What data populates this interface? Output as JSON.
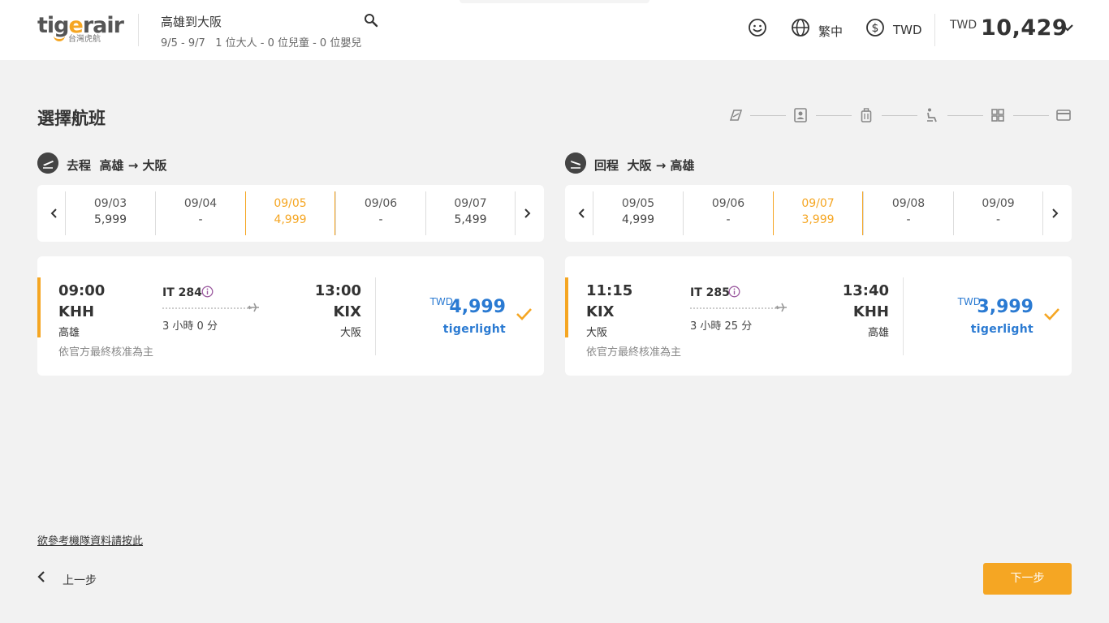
{
  "header": {
    "logo_text": "tigerair",
    "logo_sub": "台灣虎航",
    "route_title": "高雄到大阪",
    "route_dates": "9/5 - 9/7",
    "passengers": "1 位大人 - 0 位兒童 - 0 位嬰兒",
    "language": "繁中",
    "currency": "TWD",
    "total_currency": "TWD",
    "total_amount": "10,429"
  },
  "page": {
    "title": "選擇航班",
    "steps": [
      "flight-icon",
      "passenger-icon",
      "baggage-icon",
      "seat-icon",
      "extras-icon",
      "payment-icon"
    ]
  },
  "outbound": {
    "direction": "去程",
    "from": "高雄",
    "to": "大阪",
    "dates": [
      {
        "date": "09/03",
        "price": "5,999",
        "selected": false
      },
      {
        "date": "09/04",
        "price": "-",
        "selected": false
      },
      {
        "date": "09/05",
        "price": "4,999",
        "selected": true
      },
      {
        "date": "09/06",
        "price": "-",
        "selected": false
      },
      {
        "date": "09/07",
        "price": "5,499",
        "selected": false
      }
    ],
    "flight": {
      "dep_time": "09:00",
      "dep_code": "KHH",
      "dep_city": "高雄",
      "flight_no": "IT 284",
      "duration": "3 小時 0 分",
      "arr_time": "13:00",
      "arr_code": "KIX",
      "arr_city": "大阪",
      "note": "依官方最終核准為主",
      "currency": "TWD",
      "price": "4,999",
      "fare": "tigerlight"
    }
  },
  "inbound": {
    "direction": "回程",
    "from": "大阪",
    "to": "高雄",
    "dates": [
      {
        "date": "09/05",
        "price": "4,999",
        "selected": false
      },
      {
        "date": "09/06",
        "price": "-",
        "selected": false
      },
      {
        "date": "09/07",
        "price": "3,999",
        "selected": true
      },
      {
        "date": "09/08",
        "price": "-",
        "selected": false
      },
      {
        "date": "09/09",
        "price": "-",
        "selected": false
      }
    ],
    "flight": {
      "dep_time": "11:15",
      "dep_code": "KIX",
      "dep_city": "大阪",
      "flight_no": "IT 285",
      "duration": "3 小時 25 分",
      "arr_time": "13:40",
      "arr_code": "KHH",
      "arr_city": "高雄",
      "note": "依官方最終核准為主",
      "currency": "TWD",
      "price": "3,999",
      "fare": "tigerlight"
    }
  },
  "footer": {
    "fleet_link": "欲參考機隊資料請按此",
    "back_label": "上一步",
    "next_label": "下一步"
  },
  "colors": {
    "accent": "#f5a623",
    "price_blue": "#2a7ad2",
    "info_purple": "#9b5a9f"
  }
}
